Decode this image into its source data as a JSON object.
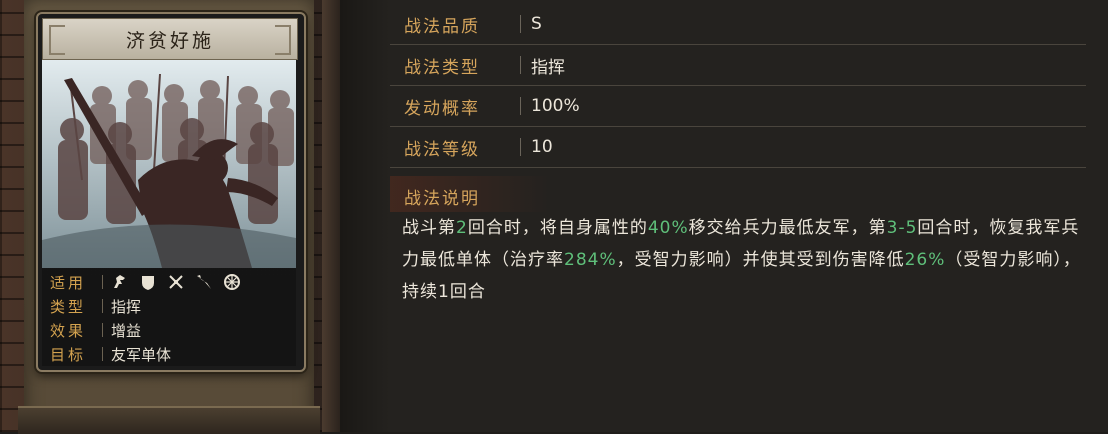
{
  "card": {
    "title": "济贫好施",
    "stats": [
      {
        "label": "适用",
        "icons": [
          "cavalry-icon",
          "shield-icon",
          "crossed-weapons-icon",
          "spear-icon",
          "wheel-icon"
        ]
      },
      {
        "label": "类型",
        "value": "指挥"
      },
      {
        "label": "效果",
        "value": "增益"
      },
      {
        "label": "目标",
        "value": "友军单体"
      }
    ]
  },
  "attributes": [
    {
      "label": "战法品质",
      "value": "S"
    },
    {
      "label": "战法类型",
      "value": "指挥"
    },
    {
      "label": "发动概率",
      "value": "100%"
    },
    {
      "label": "战法等级",
      "value": "10"
    }
  ],
  "description": {
    "title": "战法说明",
    "segments": [
      {
        "text": "战斗第",
        "hl": false
      },
      {
        "text": "2",
        "hl": true
      },
      {
        "text": "回合时，将自身属性的",
        "hl": false
      },
      {
        "text": "40%",
        "hl": true
      },
      {
        "text": "移交给兵力最低友军，第",
        "hl": false
      },
      {
        "text": "3-5",
        "hl": true
      },
      {
        "text": "回合时，恢复我军兵力最低单体（治疗率",
        "hl": false
      },
      {
        "text": "284%",
        "hl": true
      },
      {
        "text": "，受智力影响）并使其受到伤害降低",
        "hl": false
      },
      {
        "text": "26%",
        "hl": true
      },
      {
        "text": "（受智力影响），持续1回合",
        "hl": false
      }
    ]
  },
  "colors": {
    "label_gold": "#d6a55c",
    "highlight_green": "#5fbf7a",
    "text": "#ece6da"
  }
}
